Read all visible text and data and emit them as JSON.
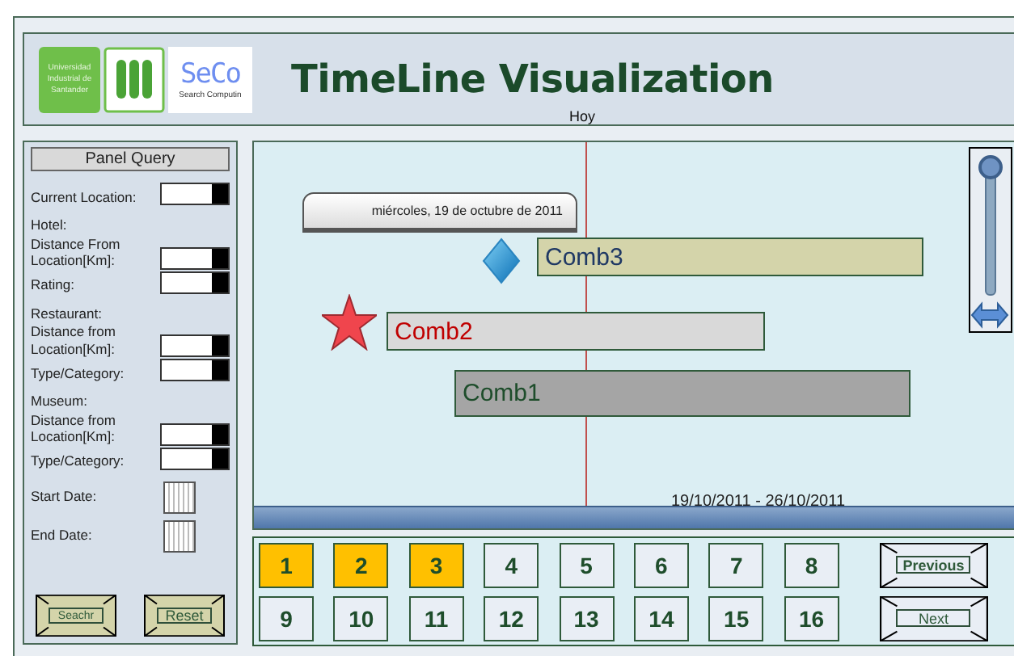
{
  "header": {
    "logo_text": "Universidad Industrial de Santander",
    "seco_logo": "SeCo",
    "seco_tagline": "Search Computin",
    "title": "TimeLine Visualization",
    "today_label": "Hoy"
  },
  "query_panel": {
    "title": "Panel Query",
    "groups": [
      {
        "fields": [
          {
            "label": "Current Location:",
            "kind": "dropdown"
          }
        ]
      },
      {
        "heading": "Hotel:",
        "fields": [
          {
            "label": "Distance From Location[Km]:",
            "kind": "dropdown"
          },
          {
            "label": "Rating:",
            "kind": "dropdown"
          }
        ]
      },
      {
        "heading": "Restaurant:",
        "fields": [
          {
            "label": "Distance from Location[Km]:",
            "kind": "dropdown"
          },
          {
            "label": "Type/Category:",
            "kind": "dropdown"
          }
        ]
      },
      {
        "heading": "Museum:",
        "fields": [
          {
            "label": "Distance from Location[Km]:",
            "kind": "dropdown"
          },
          {
            "label": "Type/Category:",
            "kind": "dropdown"
          }
        ]
      },
      {
        "fields": [
          {
            "label": "Start Date:",
            "kind": "date"
          },
          {
            "label": "End Date:",
            "kind": "date"
          }
        ]
      }
    ],
    "buttons": [
      "Seachr",
      "Reset"
    ]
  },
  "timeline": {
    "date_tooltip": "miércoles, 19 de octubre de 2011",
    "items": [
      {
        "label": "Comb3",
        "kind": "diamond",
        "color": "#d4d4aa"
      },
      {
        "label": "Comb2",
        "kind": "star",
        "color": "#d9d9d9"
      },
      {
        "label": "Comb1",
        "kind": "plain",
        "color": "#a5a5a5"
      }
    ],
    "range": "19/10/2011 - 26/10/2011",
    "zoom": {
      "level": 1
    }
  },
  "pages": {
    "numbers": [
      {
        "label": "1",
        "selected": true
      },
      {
        "label": "2",
        "selected": true
      },
      {
        "label": "3",
        "selected": true
      },
      {
        "label": "4",
        "selected": false
      },
      {
        "label": "5",
        "selected": false
      },
      {
        "label": "6",
        "selected": false
      },
      {
        "label": "7",
        "selected": false
      },
      {
        "label": "8",
        "selected": false
      },
      {
        "label": "9",
        "selected": false
      },
      {
        "label": "10",
        "selected": false
      },
      {
        "label": "11",
        "selected": false
      },
      {
        "label": "12",
        "selected": false
      },
      {
        "label": "13",
        "selected": false
      },
      {
        "label": "14",
        "selected": false
      },
      {
        "label": "15",
        "selected": false
      },
      {
        "label": "16",
        "selected": false
      }
    ],
    "previous": "Previous",
    "next": "Next"
  }
}
